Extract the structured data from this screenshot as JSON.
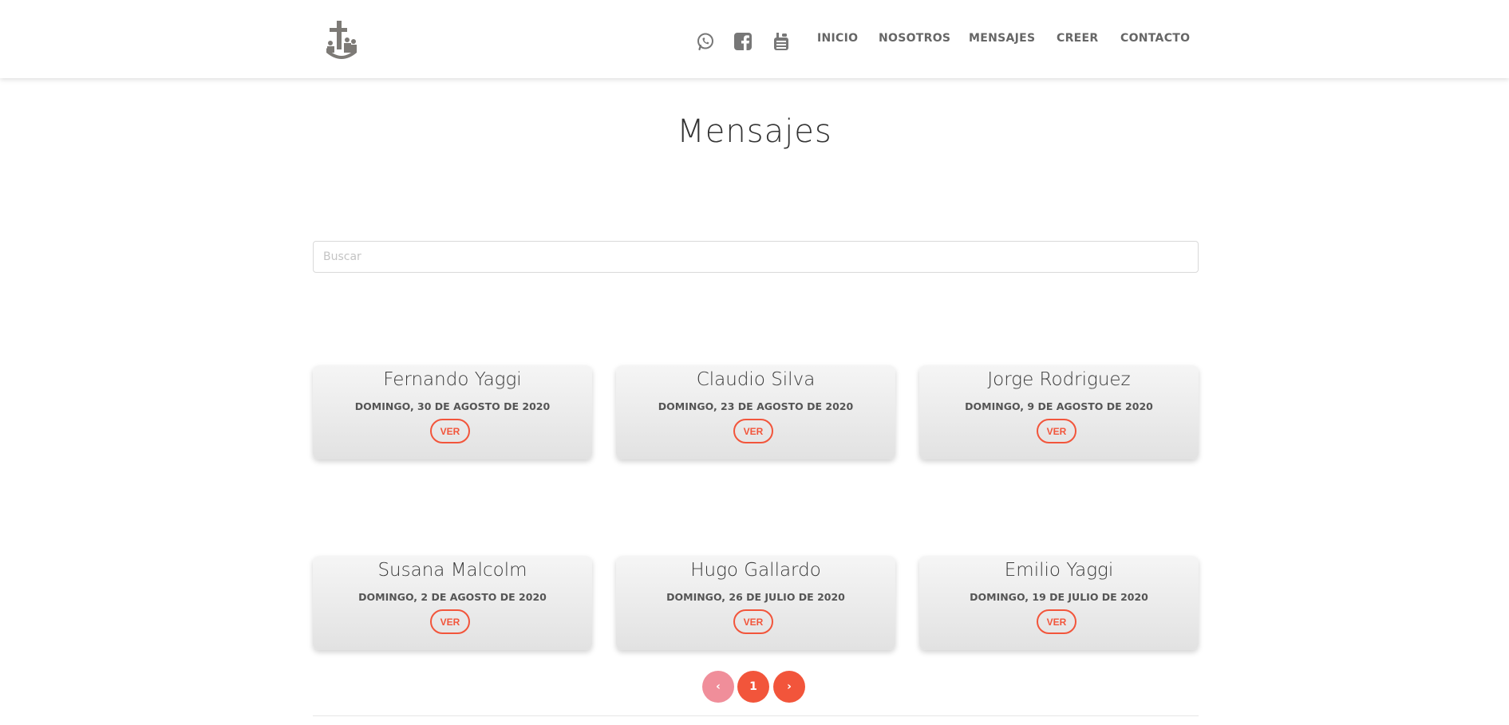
{
  "header": {
    "logo_alt": "logo",
    "social": [
      "whatsapp-icon",
      "facebook-icon",
      "youtube-icon"
    ],
    "nav": [
      "INICIO",
      "NOSOTROS",
      "MENSAJES",
      "CREER",
      "CONTACTO"
    ]
  },
  "page": {
    "title": "Mensajes"
  },
  "search": {
    "placeholder": "Buscar",
    "value": ""
  },
  "cards": [
    {
      "name": "Fernando Yaggi",
      "date": "DOMINGO, 30 DE AGOSTO DE 2020",
      "button": "VER"
    },
    {
      "name": "Claudio Silva",
      "date": "DOMINGO, 23 DE AGOSTO DE 2020",
      "button": "VER"
    },
    {
      "name": "Jorge Rodriguez",
      "date": "DOMINGO, 9 DE AGOSTO DE 2020",
      "button": "VER"
    },
    {
      "name": "Susana Malcolm",
      "date": "DOMINGO, 2 DE AGOSTO DE 2020",
      "button": "VER"
    },
    {
      "name": "Hugo Gallardo",
      "date": "DOMINGO, 26 DE JULIO DE 2020",
      "button": "VER"
    },
    {
      "name": "Emilio Yaggi",
      "date": "DOMINGO, 19 DE JULIO DE 2020",
      "button": "VER"
    }
  ],
  "pagination": {
    "prev": "‹",
    "current": "1",
    "next": "›"
  },
  "colors": {
    "accent": "#f2553b",
    "accent_disabled": "#f08e9a",
    "nav_text": "#666666",
    "icon": "#777777"
  }
}
